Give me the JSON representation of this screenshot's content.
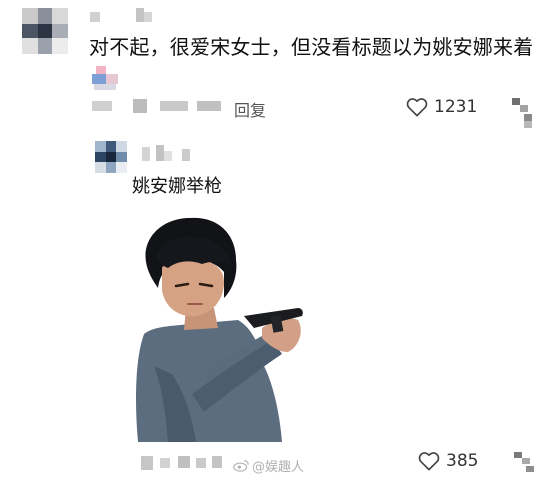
{
  "comment": {
    "text": "对不起，很爱宋女士，但没看标题以为姚安娜来着",
    "reply_label": "回复",
    "likes": "1231"
  },
  "reply": {
    "text": "姚安娜举枪",
    "likes": "385"
  },
  "watermark": {
    "text": "@娱趣人"
  },
  "icons": {
    "like": "heart-outline-icon",
    "more": "more-options-icon",
    "watermark": "weibo-logo-icon"
  },
  "colors": {
    "text": "#111111",
    "muted": "#555555",
    "blur": "#bdbdbd"
  }
}
